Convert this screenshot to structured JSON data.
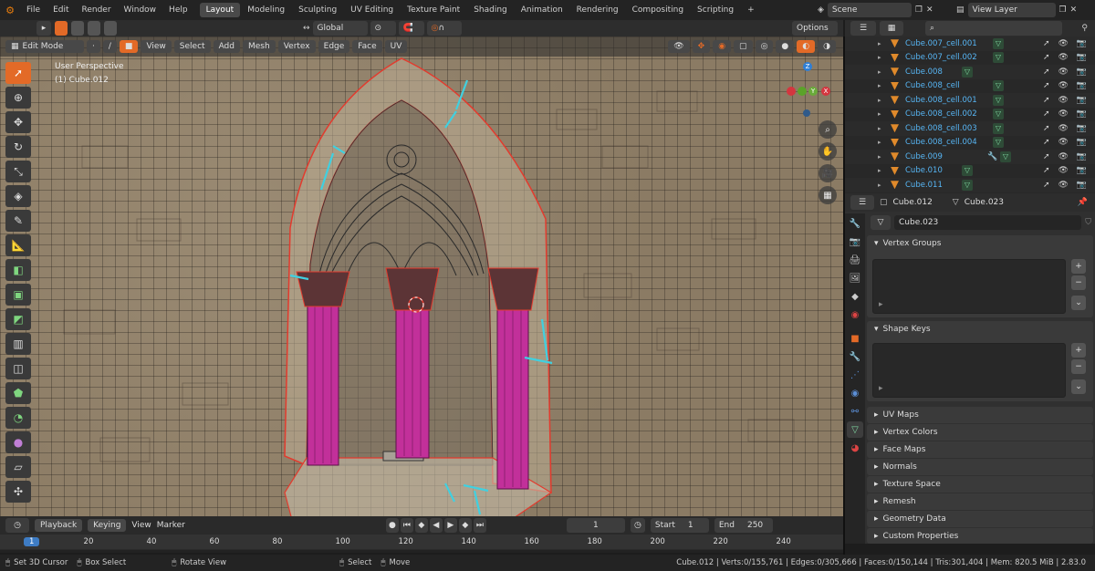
{
  "topbar": {
    "menus": [
      "File",
      "Edit",
      "Render",
      "Window",
      "Help"
    ],
    "workspaces": [
      "Layout",
      "Modeling",
      "Sculpting",
      "UV Editing",
      "Texture Paint",
      "Shading",
      "Animation",
      "Rendering",
      "Compositing",
      "Scripting"
    ],
    "active_workspace": "Layout",
    "plus": "+",
    "scene": "Scene",
    "view_layer": "View Layer"
  },
  "toolheader": {
    "transform": "Global",
    "options": "Options"
  },
  "viewport_header": {
    "mode": "Edit Mode",
    "menus": [
      "View",
      "Select",
      "Add",
      "Mesh",
      "Vertex",
      "Edge",
      "Face",
      "UV"
    ]
  },
  "viewport": {
    "perspective": "User Perspective",
    "object": "(1) Cube.012",
    "axes": {
      "z": "Z",
      "x": "X",
      "y": "Y"
    }
  },
  "outliner": {
    "rows": [
      {
        "name": "Cube.007_cell.001",
        "extra": "mesh"
      },
      {
        "name": "Cube.007_cell.002",
        "extra": "mesh"
      },
      {
        "name": "Cube.008",
        "extra": "mesh"
      },
      {
        "name": "Cube.008_cell",
        "extra": "mesh"
      },
      {
        "name": "Cube.008_cell.001",
        "extra": "mesh"
      },
      {
        "name": "Cube.008_cell.002",
        "extra": "mesh"
      },
      {
        "name": "Cube.008_cell.003",
        "extra": "mesh"
      },
      {
        "name": "Cube.008_cell.004",
        "extra": "mesh"
      },
      {
        "name": "Cube.009",
        "extra": "wrench"
      },
      {
        "name": "Cube.010",
        "extra": "mesh"
      },
      {
        "name": "Cube.011",
        "extra": "mesh"
      }
    ]
  },
  "properties": {
    "object": "Cube.012",
    "mesh": "Cube.023",
    "mesh_field": "Cube.023",
    "vertex_groups": "Vertex Groups",
    "shape_keys": "Shape Keys",
    "collapsed": [
      "UV Maps",
      "Vertex Colors",
      "Face Maps",
      "Normals",
      "Texture Space",
      "Remesh",
      "Geometry Data",
      "Custom Properties"
    ]
  },
  "timeline": {
    "menus": [
      "Playback",
      "Keying",
      "View",
      "Marker"
    ],
    "current_frame": "1",
    "start_label": "Start",
    "start": "1",
    "end_label": "End",
    "end": "250",
    "ticks": [
      "1",
      "20",
      "40",
      "60",
      "80",
      "100",
      "120",
      "140",
      "160",
      "180",
      "200",
      "220",
      "240"
    ]
  },
  "statusbar": {
    "hint1": "Set 3D Cursor",
    "hint2": "Box Select",
    "hint3": "Rotate View",
    "hint4": "Select",
    "hint5": "Move",
    "stats": "Cube.012 | Verts:0/155,761 | Edges:0/305,666 | Faces:0/150,144 | Tris:301,404 | Mem: 820.5 MiB | 2.83.0"
  },
  "colors": {
    "accent": "#e36a27",
    "selected_blue": "#57b6f5",
    "column_magenta": "#c2309a",
    "edge_red": "#e23b2e",
    "seam_cyan": "#40d0e0"
  }
}
